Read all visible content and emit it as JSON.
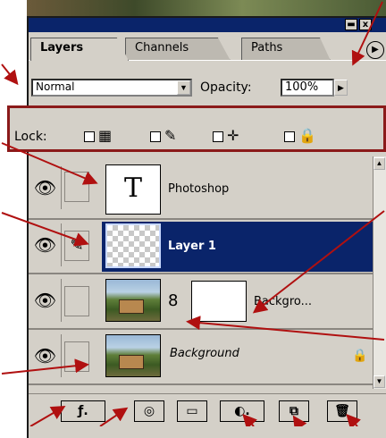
{
  "palette": {
    "title_buttons": [
      "▬",
      "x"
    ],
    "tabs": [
      {
        "label": "Layers",
        "active": true
      },
      {
        "label": "Channels",
        "active": false
      },
      {
        "label": "Paths",
        "active": false
      }
    ],
    "menu_arrow": "▶"
  },
  "blend": {
    "mode": "Normal",
    "dropdown_arrow": "▼",
    "opacity_label": "Opacity:",
    "opacity_value": "100%",
    "opacity_arrow": "▶"
  },
  "lock": {
    "label": "Lock:",
    "icons": [
      "transparency-lock-icon",
      "brush-lock-icon",
      "move-lock-icon",
      "padlock-icon"
    ],
    "glyphs": [
      "▦",
      "✎",
      "✛",
      "🔒"
    ]
  },
  "layers": [
    {
      "name": "Photoshop",
      "type": "text",
      "thumb_glyph": "T",
      "visible": true,
      "selected": false
    },
    {
      "name": "Layer 1",
      "type": "transparent",
      "visible": true,
      "selected": true,
      "link_glyph": "✎"
    },
    {
      "name": "Backgro...",
      "type": "photo-with-mask",
      "visible": true,
      "selected": false,
      "chain_glyph": "8"
    },
    {
      "name": "Background",
      "type": "photo",
      "visible": true,
      "selected": false,
      "locked": true
    }
  ],
  "eye_glyph": "👁",
  "scroll": {
    "up": "▲",
    "down": "▼"
  },
  "toolbar": {
    "glyphs": [
      "ƒ.",
      "◎",
      "▭",
      "◐.",
      "⧉",
      "🗑"
    ],
    "names": [
      "layer-style-button",
      "add-mask-button",
      "new-set-button",
      "new-fill-adjustment-button",
      "new-layer-button",
      "delete-layer-button"
    ]
  },
  "colors": {
    "selection": "#0a246a",
    "callout": "#b01010",
    "panel": "#d4d0c8"
  }
}
